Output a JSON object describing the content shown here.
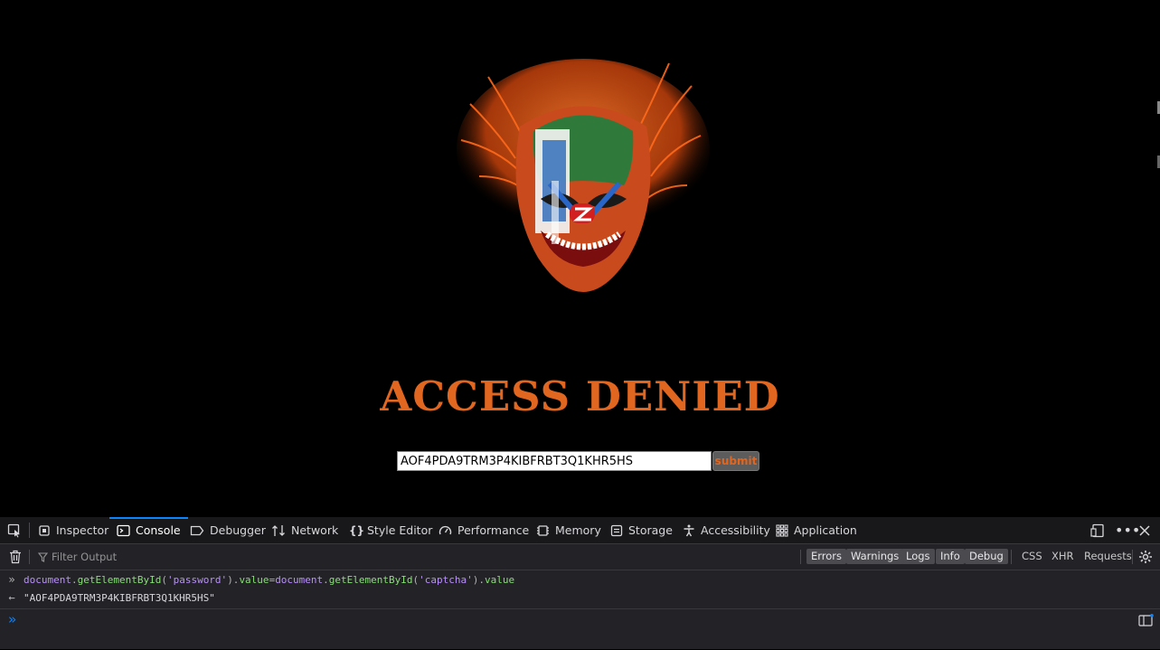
{
  "page": {
    "title": "ACCESS DENIED",
    "password_value": "AOF4PDA9TRM3P4KIBFRBT3Q1KHR5HS",
    "submit_label": "submit",
    "accent_color": "#e1661f",
    "image": "clown-face-icon"
  },
  "devtools": {
    "tabs": [
      {
        "label": "Inspector",
        "icon": "inspector-icon"
      },
      {
        "label": "Console",
        "icon": "console-icon",
        "active": true
      },
      {
        "label": "Debugger",
        "icon": "debugger-icon"
      },
      {
        "label": "Network",
        "icon": "network-icon"
      },
      {
        "label": "Style Editor",
        "icon": "style-editor-icon"
      },
      {
        "label": "Performance",
        "icon": "performance-icon"
      },
      {
        "label": "Memory",
        "icon": "memory-icon"
      },
      {
        "label": "Storage",
        "icon": "storage-icon"
      },
      {
        "label": "Accessibility",
        "icon": "accessibility-icon"
      },
      {
        "label": "Application",
        "icon": "application-icon"
      }
    ],
    "filter_placeholder": "Filter Output",
    "filters": [
      "Errors",
      "Warnings",
      "Logs",
      "Info",
      "Debug"
    ],
    "extra_filters": [
      "CSS",
      "XHR",
      "Requests"
    ],
    "console": {
      "input_parts": {
        "p1": "document",
        "p2": ".",
        "p3": "getElementById",
        "p4": "(",
        "p5": "'password'",
        "p6": ").",
        "p7": "value",
        "p8": "=",
        "p9": "document",
        "p10": ".",
        "p11": "getElementById",
        "p12": "(",
        "p13": "'captcha'",
        "p14": ").",
        "p15": "value"
      },
      "result": "\"AOF4PDA9TRM3P4KIBFRBT3Q1KHR5HS\""
    }
  }
}
